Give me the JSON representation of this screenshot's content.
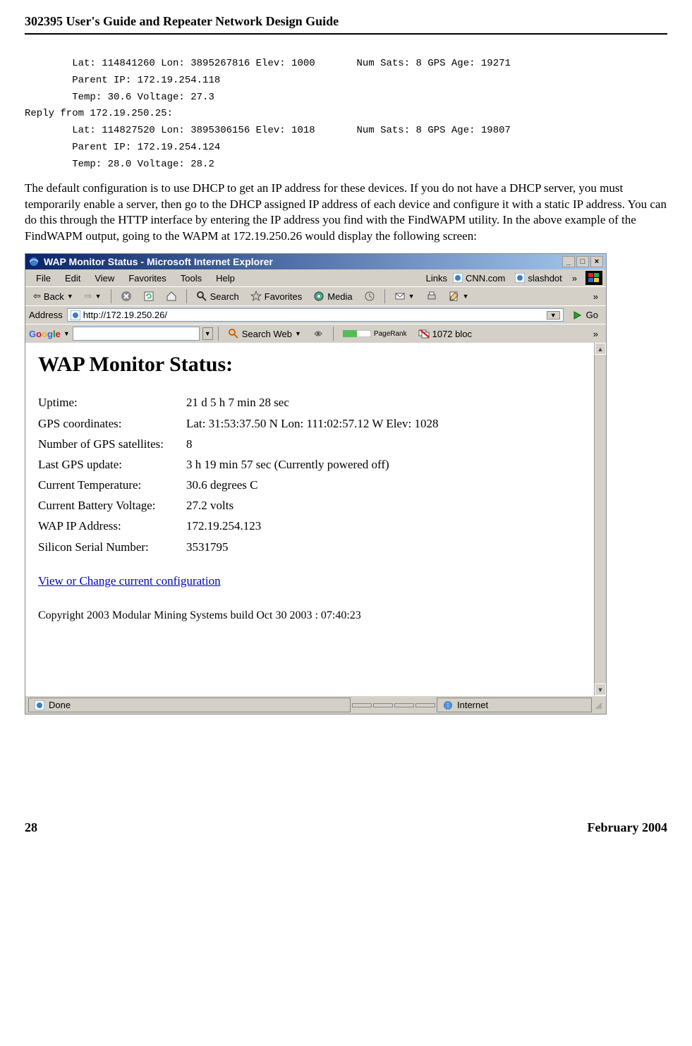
{
  "doc": {
    "header": "302395 User's Guide and Repeater Network Design Guide",
    "mono": "        Lat: 114841260 Lon: 3895267816 Elev: 1000       Num Sats: 8 GPS Age: 19271\n        Parent IP: 172.19.254.118\n        Temp: 30.6 Voltage: 27.3\nReply from 172.19.250.25:\n        Lat: 114827520 Lon: 3895306156 Elev: 1018       Num Sats: 8 GPS Age: 19807\n        Parent IP: 172.19.254.124\n        Temp: 28.0 Voltage: 28.2",
    "para": "The default configuration is to use DHCP to get an IP address for these devices. If you do not have a DHCP server, you must temporarily enable a server, then go to the DHCP assigned IP address of each device and configure it with a static IP address. You can do this through the HTTP interface by entering the IP address you find with the FindWAPM utility. In the above example of the FindWAPM output, going to the WAPM at 172.19.250.26 would display the following screen:",
    "page_number": "28",
    "footer_date": "February 2004"
  },
  "window": {
    "title": "WAP Monitor Status - Microsoft Internet Explorer",
    "menu": {
      "file": "File",
      "edit": "Edit",
      "view": "View",
      "favorites": "Favorites",
      "tools": "Tools",
      "help": "Help"
    },
    "links_label": "Links",
    "link_cnn": "CNN.com",
    "link_slashdot": "slashdot",
    "toolbar": {
      "back": "Back",
      "search": "Search",
      "favorites": "Favorites",
      "media": "Media"
    },
    "address_label": "Address",
    "address_value": "http://172.19.250.26/",
    "go": "Go",
    "google": {
      "brand": "Google",
      "search_web": "Search Web",
      "pagerank": "PageRank",
      "blocked": "1072 bloc"
    },
    "status_done": "Done",
    "status_zone": "Internet"
  },
  "page": {
    "heading": "WAP Monitor Status:",
    "rows": {
      "uptime_label": "Uptime:",
      "uptime_val": "21 d 5 h 7 min 28 sec",
      "gps_label": "GPS coordinates:",
      "gps_val": "Lat: 31:53:37.50 N Lon: 111:02:57.12 W Elev: 1028",
      "sats_label": "Number of GPS satellites:",
      "sats_val": "8",
      "lastgps_label": "Last GPS update:",
      "lastgps_val": "3 h 19 min 57 sec (Currently powered off)",
      "temp_label": "Current Temperature:",
      "temp_val": "30.6 degrees C",
      "volt_label": "Current Battery Voltage:",
      "volt_val": "27.2 volts",
      "wapip_label": "WAP IP Address:",
      "wapip_val": "172.19.254.123",
      "serial_label": "Silicon Serial Number:",
      "serial_val": "3531795"
    },
    "config_link": "View or Change current configuration",
    "copyright": "Copyright 2003 Modular Mining Systems build Oct 30 2003 : 07:40:23"
  }
}
